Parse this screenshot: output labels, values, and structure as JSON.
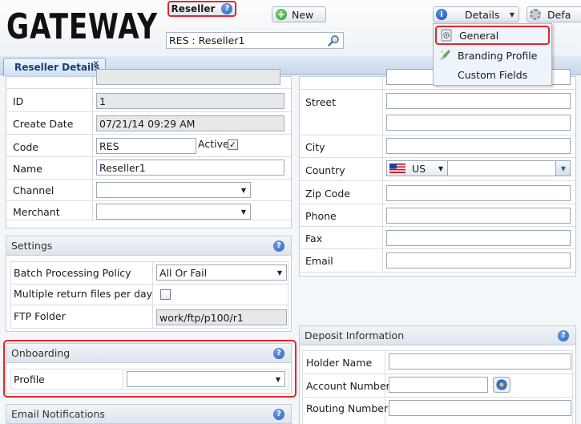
{
  "header": {
    "logo": "GATEWAY",
    "reseller_label": "Reseller",
    "new_label": "New",
    "details_label": "Details",
    "default_label": "Defa",
    "search_value": "RES : Reseller1"
  },
  "details_menu": {
    "items": [
      {
        "label": "General",
        "icon": "gear-doc-icon"
      },
      {
        "label": "Branding Profile",
        "icon": "brush-icon"
      },
      {
        "label": "Custom Fields",
        "icon": ""
      }
    ]
  },
  "tabs": [
    {
      "label": "Reseller Details",
      "close": "×"
    }
  ],
  "general": {
    "id_label": "ID",
    "id_value": "1",
    "create_label": "Create Date",
    "create_value": "07/21/14 09:29 AM",
    "code_label": "Code",
    "code_value": "RES",
    "active_label": "Active",
    "active_checked": "✓",
    "name_label": "Name",
    "name_value": "Reseller1",
    "channel_label": "Channel",
    "channel_value": "",
    "merchant_label": "Merchant",
    "merchant_value": ""
  },
  "settings": {
    "title": "Settings",
    "batch_label": "Batch Processing Policy",
    "batch_value": "All Or Fail",
    "multi_label": "Multiple return files per day",
    "ftp_label": "FTP Folder",
    "ftp_value": "work/ftp/p100/r1"
  },
  "onboarding": {
    "title": "Onboarding",
    "profile_label": "Profile",
    "profile_value": ""
  },
  "email": {
    "title": "Email Notifications"
  },
  "address": {
    "street_label": "Street",
    "city_label": "City",
    "country_label": "Country",
    "country_value": "US",
    "zip_label": "Zip Code",
    "phone_label": "Phone",
    "fax_label": "Fax",
    "email_label": "Email"
  },
  "deposit": {
    "title": "Deposit Information",
    "holder_label": "Holder Name",
    "account_label": "Account Number",
    "routing_label": "Routing Number"
  },
  "colors": {
    "highlight": "#e8242b",
    "tab_text": "#1b3e6f"
  }
}
